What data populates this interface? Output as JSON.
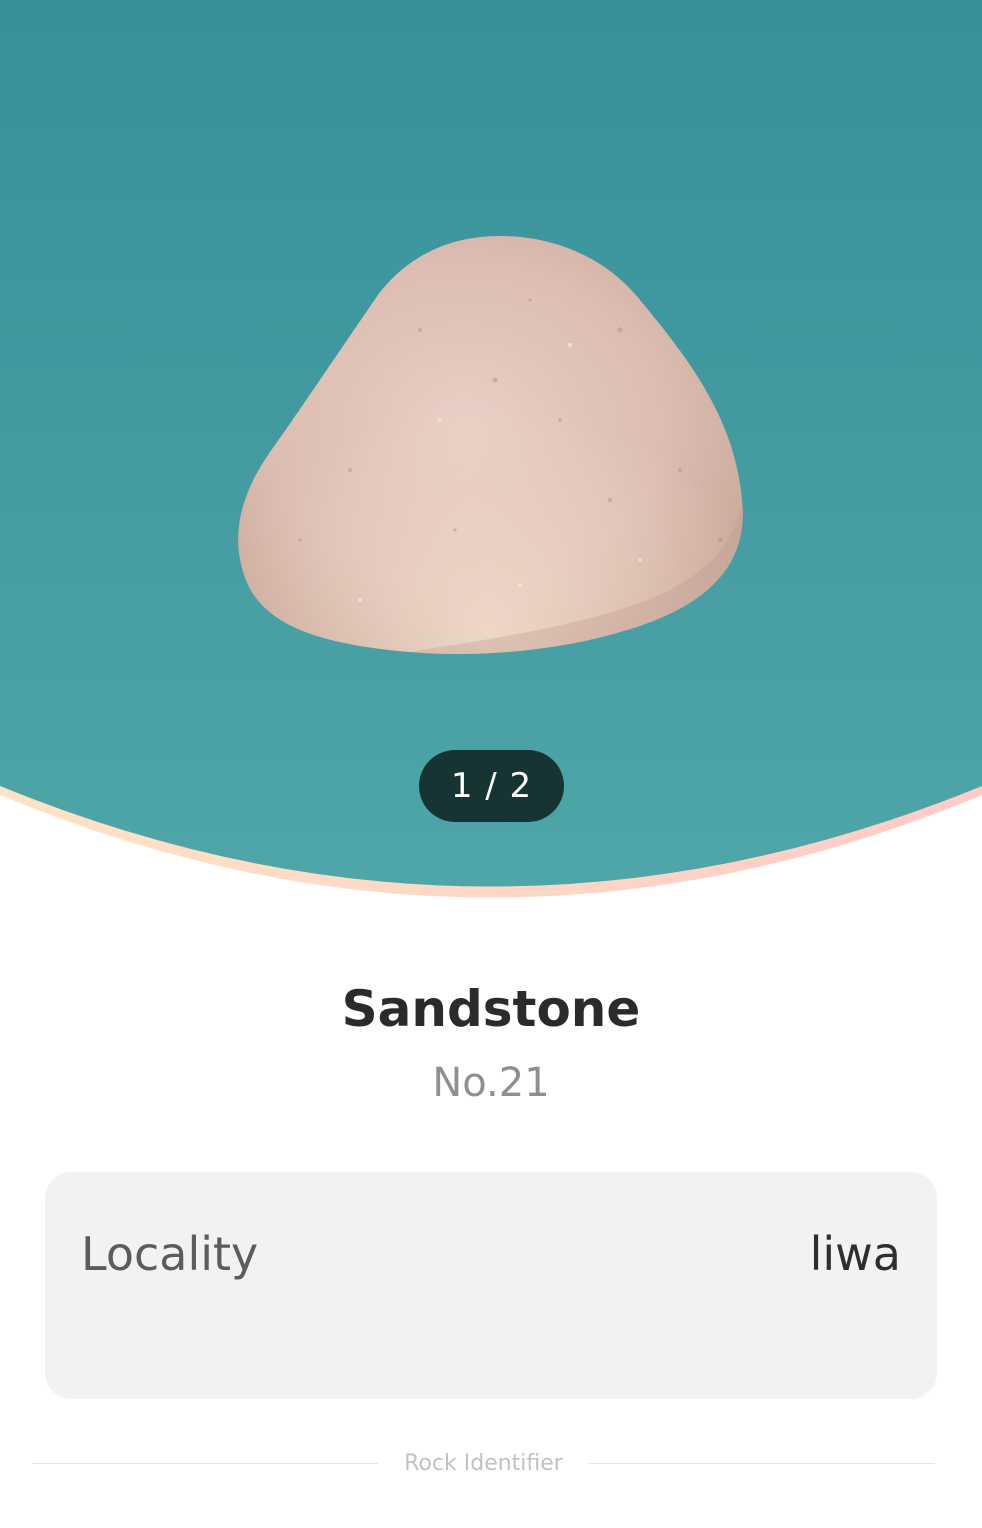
{
  "hero": {
    "image": "sandstone-pebble-photo",
    "background_top_color": "#37909A",
    "background_bottom_color": "#4FA6A8",
    "arc_gradient": [
      "#FDE3C5",
      "#FFD0CB"
    ],
    "pager": "1 / 2"
  },
  "rock": {
    "name": "Sandstone",
    "number": "No.21"
  },
  "details": {
    "locality_label": "Locality",
    "locality_value": "liwa"
  },
  "footer": {
    "brand": "Rock Identifier"
  }
}
